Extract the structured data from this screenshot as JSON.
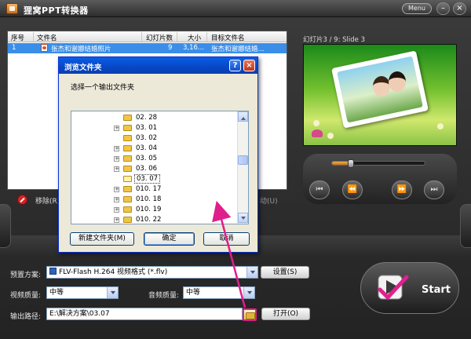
{
  "window": {
    "title": "狸窝PPT转换器",
    "menu_label": "Menu",
    "minimize_symbol": "–",
    "close_symbol": "×"
  },
  "file_list": {
    "columns": [
      "序号",
      "文件名",
      "幻灯片数",
      "大小",
      "目标文件名"
    ],
    "rows": [
      {
        "index": "1",
        "filename": "张杰和谢娜结婚照片",
        "slides": "9",
        "size": "3,16...",
        "target": "张杰和谢娜结婚..."
      }
    ],
    "delete_label": "移除(R)",
    "partial_right_label": "动(U)"
  },
  "preview": {
    "label": "幻灯片3 / 9: Slide 3",
    "seek_fraction": 0.2
  },
  "player_controls": [
    {
      "name": "first-slide-button",
      "symbol": "⏮"
    },
    {
      "name": "prev-slide-button",
      "symbol": "⏪"
    },
    {
      "name": "next-slide-button",
      "symbol": "⏩"
    },
    {
      "name": "last-slide-button",
      "symbol": "⏭"
    }
  ],
  "settings": {
    "preset_label": "预置方案:",
    "preset_value": "FLV-Flash H.264 视频格式 (*.flv)",
    "preset_button": "设置(S)",
    "video_quality_label": "视频质量:",
    "video_quality_value": "中等",
    "audio_quality_label": "音频质量:",
    "audio_quality_value": "中等",
    "output_path_label": "输出路径:",
    "output_path_value": "E:\\解决方案\\03.07",
    "open_button": "打开(O)",
    "start_label": "Start"
  },
  "browse_dialog": {
    "title": "浏览文件夹",
    "help_symbol": "?",
    "close_symbol": "×",
    "prompt": "选择一个输出文件夹",
    "folders": [
      {
        "name": "02. 28",
        "expandable": false,
        "selected": false
      },
      {
        "name": "03. 01",
        "expandable": true,
        "selected": false
      },
      {
        "name": "03. 02",
        "expandable": false,
        "selected": false
      },
      {
        "name": "03. 04",
        "expandable": true,
        "selected": false
      },
      {
        "name": "03. 05",
        "expandable": true,
        "selected": false
      },
      {
        "name": "03. 06",
        "expandable": true,
        "selected": false
      },
      {
        "name": "03. 07",
        "expandable": false,
        "selected": true
      },
      {
        "name": "010. 17",
        "expandable": true,
        "selected": false
      },
      {
        "name": "010. 18",
        "expandable": true,
        "selected": false
      },
      {
        "name": "010. 19",
        "expandable": true,
        "selected": false
      },
      {
        "name": "010. 22",
        "expandable": true,
        "selected": false
      }
    ],
    "new_folder_button": "新建文件夹(M)",
    "ok_button": "确定",
    "cancel_button": "取消"
  },
  "colors": {
    "selection_blue": "#3a8ee8",
    "xp_title_blue": "#0a5ee6",
    "annotation_pink": "#e01e8c"
  }
}
